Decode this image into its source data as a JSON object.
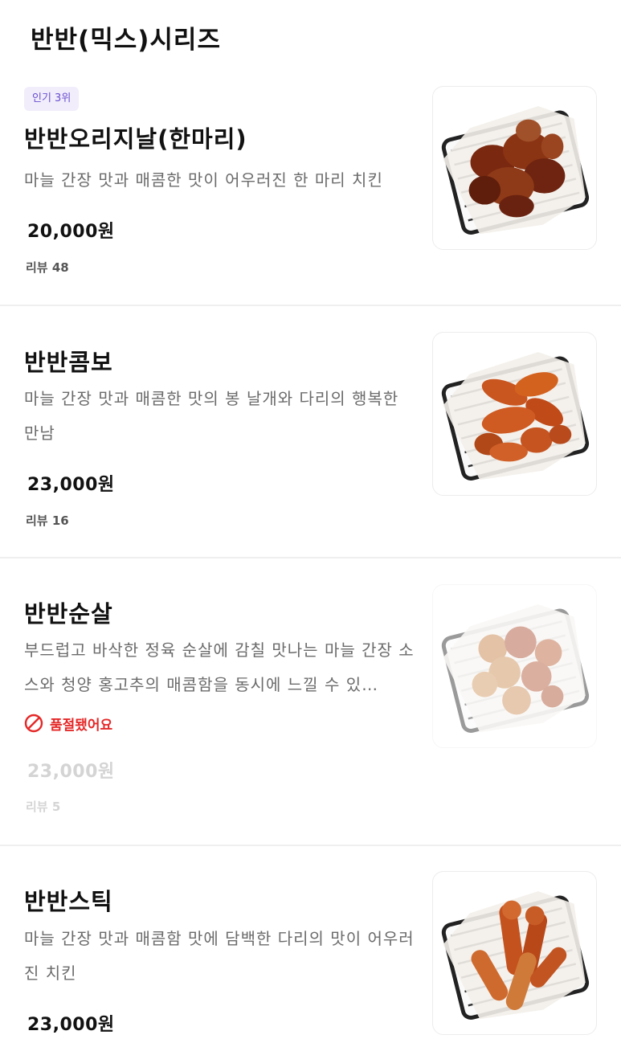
{
  "section": {
    "title": "반반(믹스)시리즈"
  },
  "items": [
    {
      "badge": "인기 3위",
      "name": "반반오리지날(한마리)",
      "description": "마늘 간장 맛과 매콤한 맛이 어우러진 한 마리 치킨",
      "price": "20,000원",
      "review": "리뷰 48",
      "image_icon": "chicken-basket-image"
    },
    {
      "name": "반반콤보",
      "description": "마늘 간장 맛과 매콤한 맛의 봉 날개와 다리의 행복한 만남",
      "price": "23,000원",
      "review": "리뷰 16",
      "image_icon": "chicken-basket-image"
    },
    {
      "name": "반반순살",
      "description": "부드럽고 바삭한 정육 순살에 감칠 맛나는 마늘 간장 소스와 청양 홍고추의 매콤함을 동시에 느낄 수 있…",
      "status": "품절됐어요",
      "price": "23,000원",
      "review": "리뷰 5",
      "image_icon": "chicken-basket-image"
    },
    {
      "name": "반반스틱",
      "description": "마늘 간장 맛과 매콤함 맛에 담백한 다리의 맛이 어우러진 치킨",
      "price": "23,000원",
      "image_icon": "chicken-basket-image"
    }
  ],
  "colors": {
    "badge_bg": "#f1edfb",
    "badge_text": "#6a4fd1",
    "soldout": "#e52828",
    "divider": "#efefef"
  }
}
